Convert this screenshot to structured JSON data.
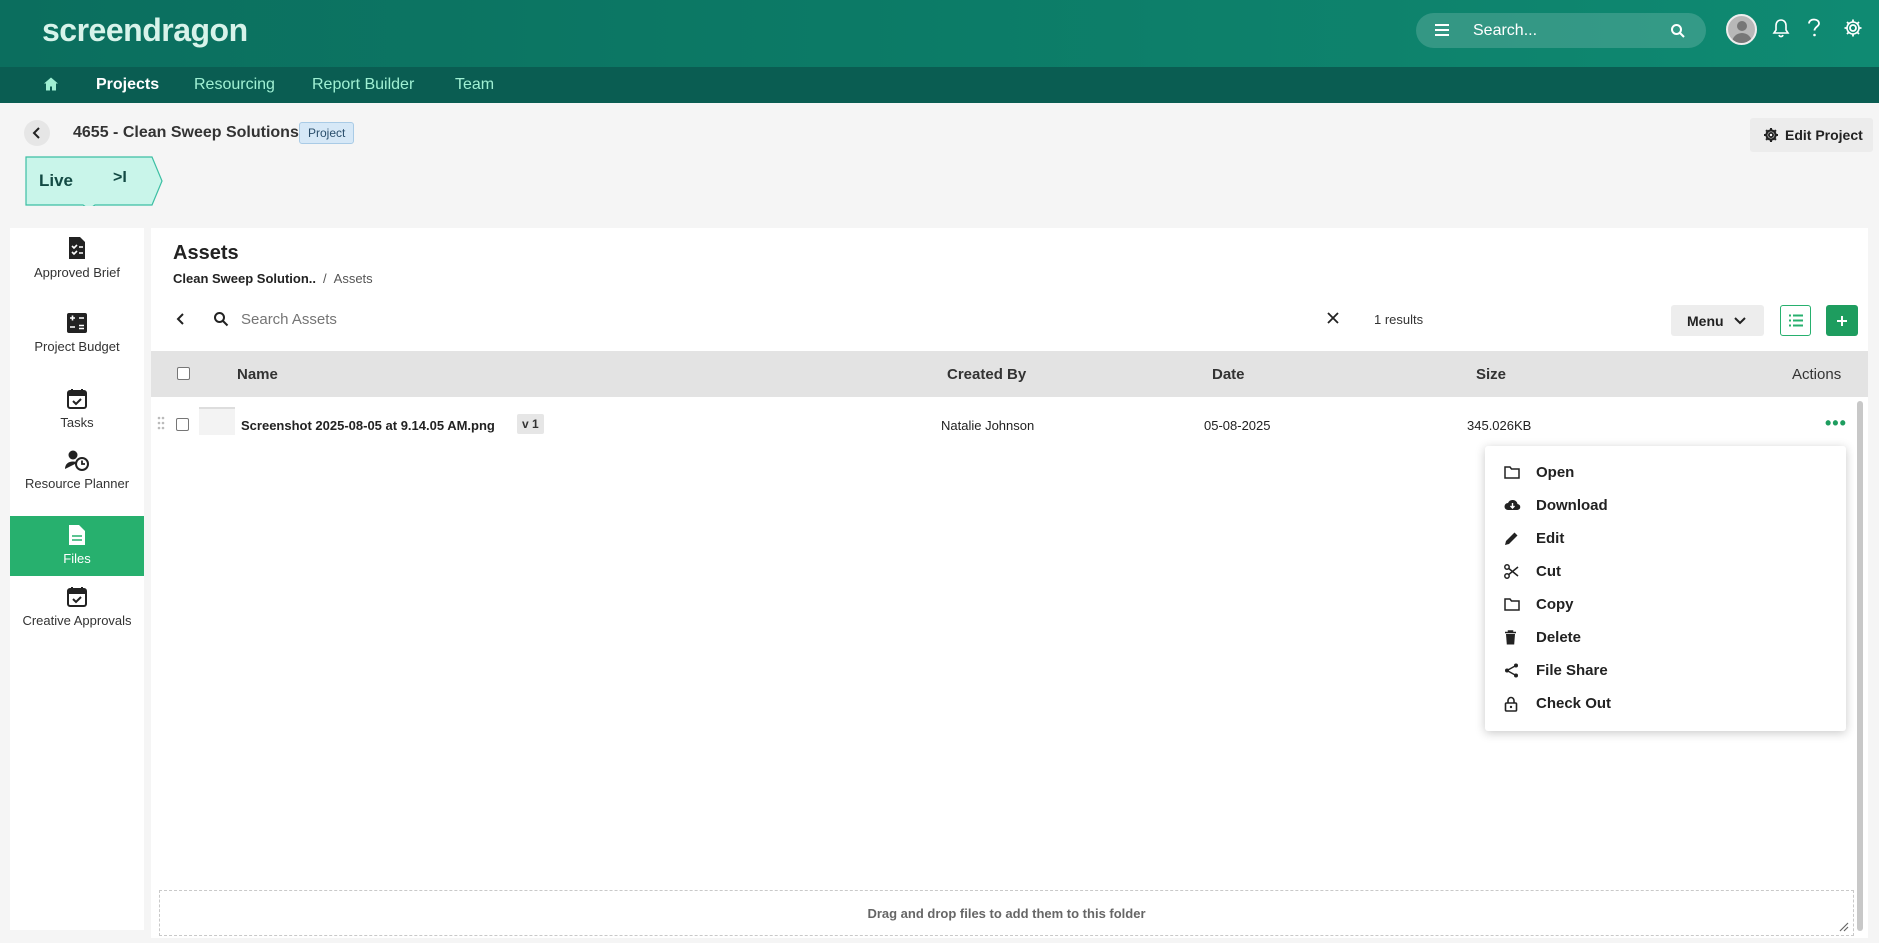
{
  "header": {
    "logo": "screendragon",
    "search_placeholder": "Search..."
  },
  "nav": {
    "items": [
      {
        "label": "Projects",
        "active": true
      },
      {
        "label": "Resourcing"
      },
      {
        "label": "Report Builder"
      },
      {
        "label": "Team"
      }
    ]
  },
  "project": {
    "title": "4655 - Clean Sweep Solutions",
    "badge": "Project",
    "edit_label": "Edit Project",
    "status": "Live",
    "status_action": ">I"
  },
  "sidebar": {
    "items": [
      {
        "label": "Approved Brief",
        "icon": "approved-brief-icon"
      },
      {
        "label": "Project Budget",
        "icon": "calculator-icon"
      },
      {
        "label": "Tasks",
        "icon": "calendar-check-icon"
      },
      {
        "label": "Resource Planner",
        "icon": "resource-planner-icon"
      },
      {
        "label": "Files",
        "icon": "file-icon",
        "active": true
      },
      {
        "label": "Creative Approvals",
        "icon": "calendar-check-icon"
      }
    ]
  },
  "assets": {
    "title": "Assets",
    "breadcrumb": [
      "Clean Sweep Solution..",
      "Assets"
    ],
    "search_placeholder": "Search Assets",
    "results": "1 results",
    "menu_label": "Menu",
    "columns": [
      "Name",
      "Created By",
      "Date",
      "Size",
      "Actions"
    ],
    "rows": [
      {
        "name": "Screenshot 2025-08-05 at 9.14.05 AM.png",
        "version": "v 1",
        "created_by": "Natalie Johnson",
        "date": "05-08-2025",
        "size": "345.026KB"
      }
    ],
    "dropzone": "Drag and drop files to add them to this folder"
  },
  "context_menu": {
    "items": [
      {
        "label": "Open",
        "icon": "folder-icon"
      },
      {
        "label": "Download",
        "icon": "cloud-download-icon"
      },
      {
        "label": "Edit",
        "icon": "pencil-icon"
      },
      {
        "label": "Cut",
        "icon": "scissors-icon"
      },
      {
        "label": "Copy",
        "icon": "folder-icon"
      },
      {
        "label": "Delete",
        "icon": "trash-icon"
      },
      {
        "label": "File Share",
        "icon": "share-icon"
      },
      {
        "label": "Check Out",
        "icon": "lock-icon"
      }
    ]
  },
  "colors": {
    "header_teal": "#0c7a66",
    "nav_dark": "#0a5d52",
    "accent_green": "#27b06e",
    "live_bg": "#c9f5ea"
  }
}
